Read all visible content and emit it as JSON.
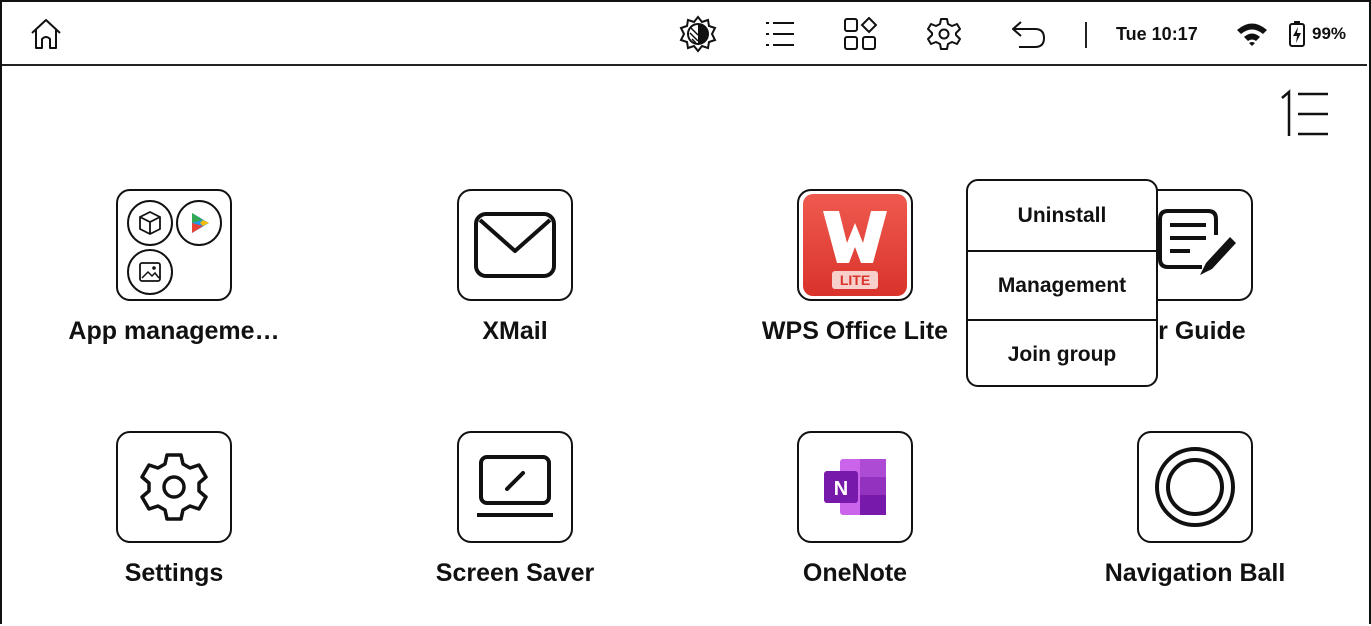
{
  "statusbar": {
    "icons": [
      "home-icon",
      "contrast-icon",
      "list-icon",
      "apps-icon",
      "settings-icon",
      "back-icon",
      "wifi-icon",
      "battery-icon"
    ],
    "clock": "Tue 10:17",
    "battery": "99%"
  },
  "apps": [
    {
      "label": "App manageme…"
    },
    {
      "label": "XMail"
    },
    {
      "label": "WPS Office Lite",
      "badge": "LITE"
    },
    {
      "label": "er Guide"
    },
    {
      "label": "Settings"
    },
    {
      "label": "Screen Saver"
    },
    {
      "label": "OneNote",
      "letter": "N"
    },
    {
      "label": "Navigation Ball"
    }
  ],
  "popup": {
    "items": [
      "Uninstall",
      "Management",
      "Join group"
    ]
  },
  "colors": {
    "wps_red": "#e8423a",
    "onenote_purple": "#7719aa"
  }
}
